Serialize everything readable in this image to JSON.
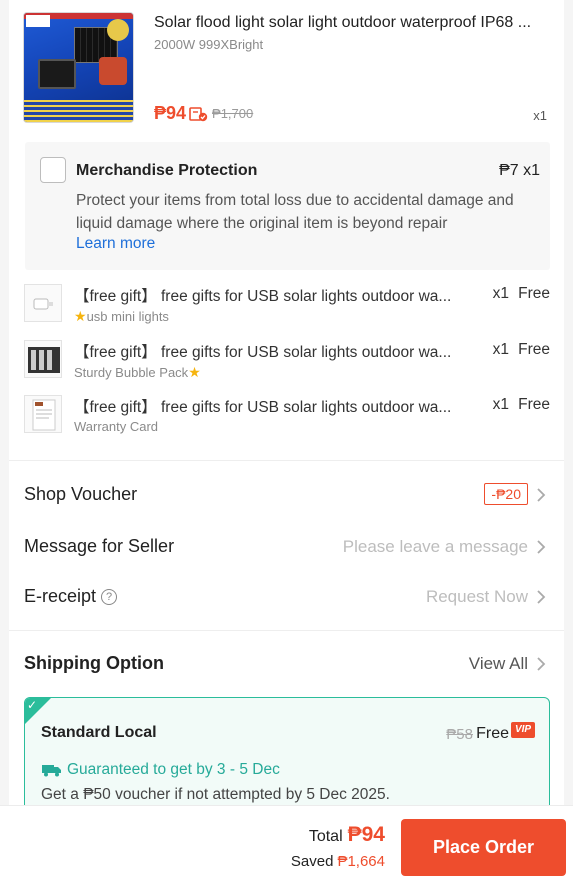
{
  "product": {
    "title": "Solar flood light solar light outdoor waterproof IP68 ...",
    "variant": "2000W 999XBright",
    "price": "₱94",
    "original_price": "₱1,700",
    "qty": "x1",
    "tag_icon": "price-tag-icon",
    "image_texts": [
      "2000W 10 Years Warranty",
      "IP68",
      "Aluminium"
    ]
  },
  "protection": {
    "title": "Merchandise Protection",
    "price_qty": "₱7  x1",
    "description": "Protect your items from total loss due to accidental damage and liquid damage where the original item is beyond repair",
    "learn_more": "Learn more",
    "checked": false
  },
  "gifts": [
    {
      "title": "【free gift】 free gifts for USB solar lights outdoor wa...",
      "qty": "x1",
      "price": "Free",
      "sub": "usb mini lights",
      "star_pos": "before"
    },
    {
      "title": "【free gift】 free gifts for USB solar lights outdoor wa...",
      "qty": "x1",
      "price": "Free",
      "sub": "Sturdy Bubble Pack",
      "star_pos": "after"
    },
    {
      "title": "【free gift】 free gifts for USB solar lights outdoor wa...",
      "qty": "x1",
      "price": "Free",
      "sub": "Warranty Card",
      "star_pos": "none"
    }
  ],
  "rows": {
    "shop_voucher": {
      "label": "Shop Voucher",
      "value": "-₱20"
    },
    "message": {
      "label": "Message for Seller",
      "placeholder": "Please leave a message"
    },
    "ereceipt": {
      "label": "E-receipt",
      "value": "Request Now"
    }
  },
  "shipping": {
    "label": "Shipping Option",
    "view_all": "View All",
    "option": "Standard Local",
    "original_fee": "₱58",
    "fee": "Free",
    "badge": "VIP",
    "guarantee": "Guaranteed to get by 3 - 5 Dec",
    "voucher_note": "Get a ₱50 voucher if not attempted by 5 Dec 2025."
  },
  "footer": {
    "total_label": "Total",
    "total": "₱94",
    "saved_label": "Saved",
    "saved": "₱1,664",
    "button": "Place Order"
  },
  "colors": {
    "accent": "#ee4d2d",
    "teal": "#26aa99",
    "link": "#1e6fd9"
  }
}
